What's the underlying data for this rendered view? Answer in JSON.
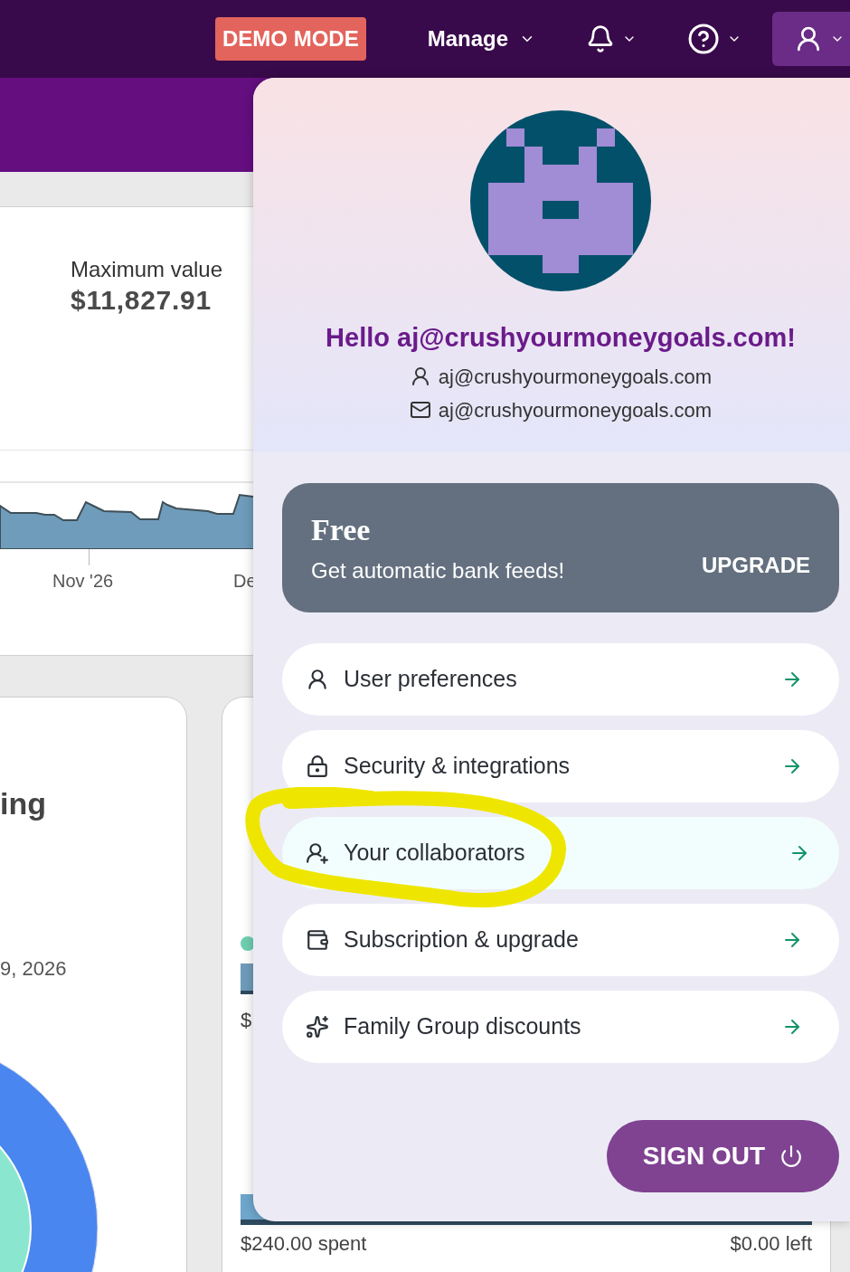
{
  "header": {
    "badge": "DEMO MODE",
    "menu": "Manage"
  },
  "background": {
    "summary": {
      "label": "Maximum value",
      "value": "$11,827.91"
    },
    "chart_ticks": [
      "Nov '26",
      "De"
    ],
    "spending_card": {
      "title": "ing",
      "date": "9, 2026"
    },
    "budget_card": {
      "mini_bar": {
        "level": 1
      },
      "amount": "$",
      "bar": {
        "level": 1
      },
      "spent": "$240.00 spent",
      "left": "$0.00 left"
    }
  },
  "account_menu": {
    "greeting": "Hello aj@crushyourmoneygoals.com!",
    "username": "aj@crushyourmoneygoals.com",
    "email": "aj@crushyourmoneygoals.com",
    "plan": {
      "name": "Free",
      "message": "Get automatic bank feeds!",
      "action": "UPGRADE"
    },
    "items": [
      {
        "label": "User preferences",
        "selected": false
      },
      {
        "label": "Security & integrations",
        "selected": false
      },
      {
        "label": "Your collaborators",
        "selected": true
      },
      {
        "label": "Subscription & upgrade",
        "selected": false
      },
      {
        "label": "Family Group discounts",
        "selected": false
      }
    ],
    "sign_out": "SIGN OUT"
  }
}
